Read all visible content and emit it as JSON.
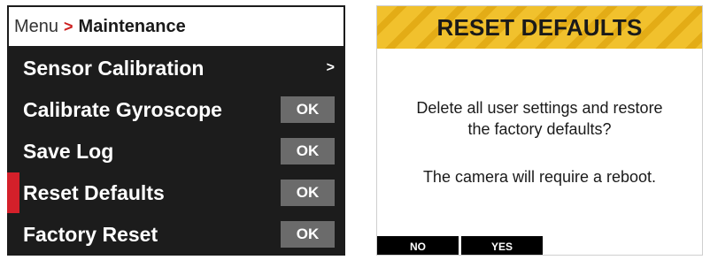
{
  "menu": {
    "breadcrumb": {
      "root": "Menu",
      "separator": ">",
      "current": "Maintenance"
    },
    "items": [
      {
        "label": "Sensor Calibration",
        "action": ">"
      },
      {
        "label": "Calibrate Gyroscope",
        "action": "OK"
      },
      {
        "label": "Save Log",
        "action": "OK"
      },
      {
        "label": "Reset Defaults",
        "action": "OK",
        "selected": true
      },
      {
        "label": "Factory Reset",
        "action": "OK"
      }
    ]
  },
  "dialog": {
    "title": "RESET DEFAULTS",
    "message_line1": "Delete all user settings and restore",
    "message_line2": "the factory defaults?",
    "note": "The camera will require a reboot.",
    "buttons": {
      "no": "NO",
      "yes": "YES"
    }
  },
  "colors": {
    "menu_background": "#1c1c1c",
    "ok_button": "#6b6b6b",
    "selection_indicator": "#d4202a",
    "breadcrumb_separator": "#cc1f1f",
    "header_stripe_light": "#f1c12d",
    "header_stripe_dark": "#e3ac16"
  }
}
